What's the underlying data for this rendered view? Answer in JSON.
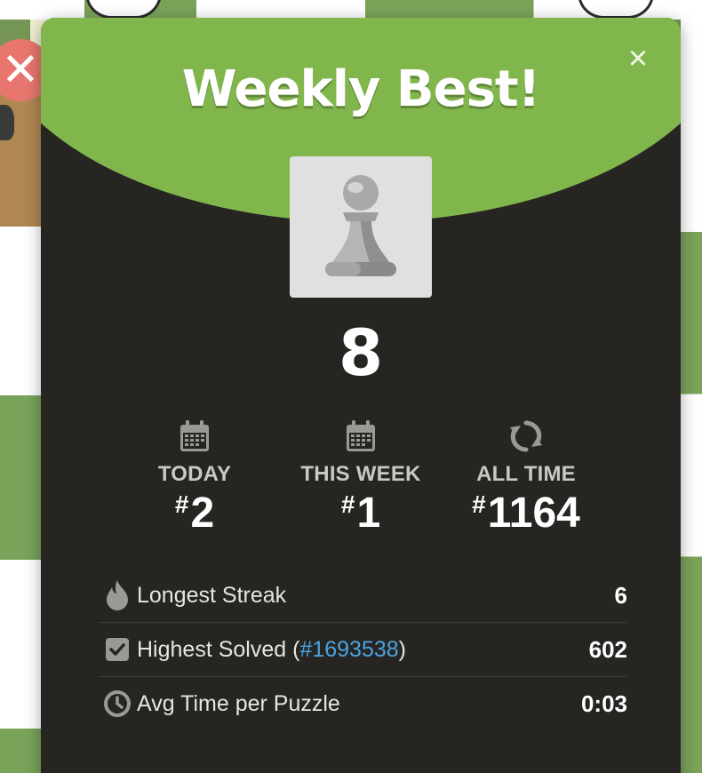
{
  "modal": {
    "title": "Weekly Best!",
    "close_symbol": "×",
    "piece_icon": "pawn-icon",
    "score": "8"
  },
  "ranks": [
    {
      "icon": "calendar-icon",
      "label": "TODAY",
      "hash": "#",
      "value": "2"
    },
    {
      "icon": "calendar-icon",
      "label": "THIS WEEK",
      "hash": "#",
      "value": "1"
    },
    {
      "icon": "refresh-icon",
      "label": "ALL TIME",
      "hash": "#",
      "value": "1164"
    }
  ],
  "stats": {
    "longest_streak": {
      "icon": "flame-icon",
      "label": "Longest Streak",
      "value": "6"
    },
    "highest_solved": {
      "icon": "checkbox-icon",
      "label_prefix": "Highest Solved (",
      "link": "#1693538",
      "label_suffix": ")",
      "value": "602"
    },
    "avg_time": {
      "icon": "clock-icon",
      "label": "Avg Time per Puzzle",
      "value": "0:03"
    }
  },
  "background": {
    "wrong_marker": "✕"
  },
  "colors": {
    "header_green": "#81b64c",
    "modal_bg": "#262522",
    "link_blue": "#4aa3e0",
    "board_green": "#769656",
    "board_light": "#eeeed2",
    "wrong_red": "#e8766f"
  }
}
